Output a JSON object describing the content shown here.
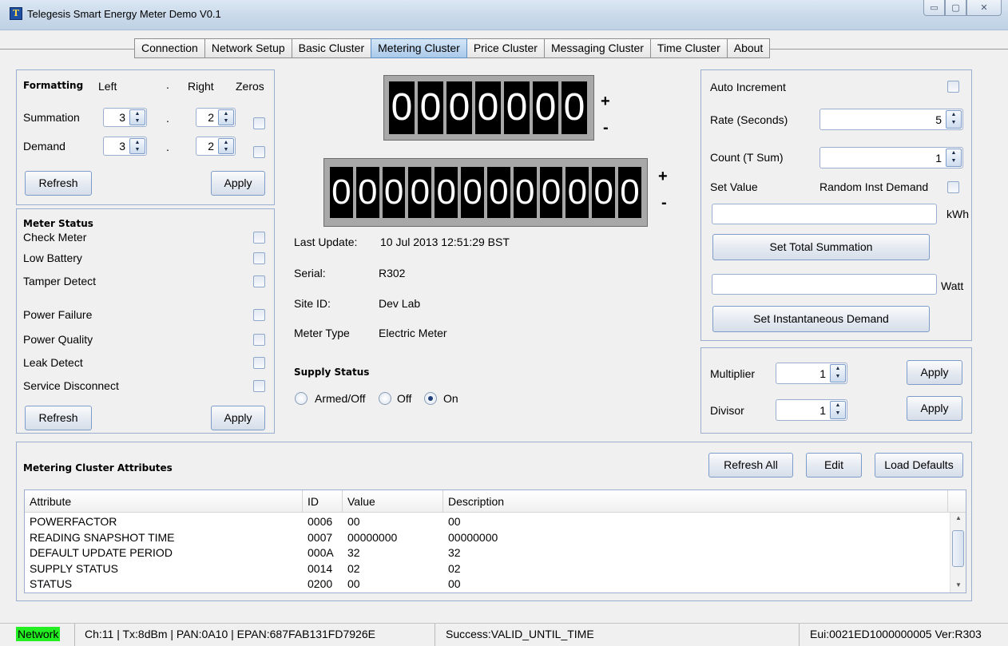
{
  "window": {
    "title": "Telegesis Smart Energy Meter Demo V0.1",
    "app_icon": "telegesis-logo-icon",
    "buttons": [
      "minimize-icon",
      "maximize-icon",
      "close-icon"
    ],
    "min_glyph": "▭",
    "max_glyph": "▢",
    "close_glyph": "✕"
  },
  "tabs": [
    {
      "label": "Connection"
    },
    {
      "label": "Network Setup"
    },
    {
      "label": "Basic Cluster"
    },
    {
      "label": "Metering Cluster",
      "active": true
    },
    {
      "label": "Price Cluster"
    },
    {
      "label": "Messaging Cluster"
    },
    {
      "label": "Time Cluster"
    },
    {
      "label": "About"
    }
  ],
  "formatting": {
    "title": "Formatting",
    "col_left": "Left",
    "col_dot": ".",
    "col_right": "Right",
    "col_zeros": "Zeros",
    "summation_label": "Summation",
    "summation_left": "3",
    "summation_right": "2",
    "demand_label": "Demand",
    "demand_left": "3",
    "demand_right": "2",
    "dot": ".",
    "refresh": "Refresh",
    "apply": "Apply"
  },
  "meter_status": {
    "title": "Meter Status",
    "items": [
      "Check Meter",
      "Low Battery",
      "Tamper Detect",
      "Power Failure",
      "Power Quality",
      "Leak Detect",
      "Service Disconnect"
    ],
    "refresh": "Refresh",
    "apply": "Apply"
  },
  "display": {
    "demand_digits": [
      "0",
      "0",
      "0",
      "0",
      "0",
      "0",
      "0"
    ],
    "summation_digits": [
      "0",
      "0",
      "0",
      "0",
      "0",
      "0",
      "0",
      "0",
      "0",
      "0",
      "0",
      "0"
    ],
    "plus": "+",
    "minus": "-"
  },
  "info": {
    "last_update_label": "Last Update:",
    "last_update_value": "10 Jul 2013 12:51:29 BST",
    "serial_label": "Serial:",
    "serial_value": "R302",
    "site_label": "Site ID:",
    "site_value": "Dev Lab",
    "type_label": "Meter Type",
    "type_value": "Electric Meter",
    "supply_title": "Supply Status",
    "supply_options": [
      "Armed/Off",
      "Off",
      "On"
    ],
    "supply_selected": "On"
  },
  "auto": {
    "auto_increment": "Auto Increment",
    "rate_label": "Rate (Seconds)",
    "rate_value": "5",
    "count_label": "Count (T Sum)",
    "count_value": "1",
    "set_value_label": "Set Value",
    "random_label": "Random Inst Demand",
    "kwh_unit": "kWh",
    "set_total": "Set Total Summation",
    "watt_unit": "Watt",
    "set_inst": "Set Instantaneous Demand"
  },
  "scaling": {
    "multiplier_label": "Multiplier",
    "multiplier_value": "1",
    "divisor_label": "Divisor",
    "divisor_value": "1",
    "apply": "Apply"
  },
  "attributes": {
    "title": "Metering Cluster Attributes",
    "refresh_all": "Refresh All",
    "edit": "Edit",
    "load_defaults": "Load Defaults",
    "columns": [
      "Attribute",
      "ID",
      "Value",
      "Description"
    ],
    "rows": [
      [
        "POWERFACTOR",
        "0006",
        "00",
        "00"
      ],
      [
        "READING SNAPSHOT TIME",
        "0007",
        "00000000",
        "00000000"
      ],
      [
        "DEFAULT UPDATE PERIOD",
        "000A",
        "32",
        "32"
      ],
      [
        "SUPPLY STATUS",
        "0014",
        "02",
        "02"
      ],
      [
        "STATUS",
        "0200",
        "00",
        "00"
      ]
    ]
  },
  "statusbar": {
    "network": "Network",
    "network_color": "#22ee22",
    "radio_info": "Ch:11 | Tx:8dBm | PAN:0A10 | EPAN:687FAB131FD7926E",
    "message": "Success:VALID_UNTIL_TIME",
    "eui": "Eui:0021ED1000000005 Ver:R303"
  }
}
